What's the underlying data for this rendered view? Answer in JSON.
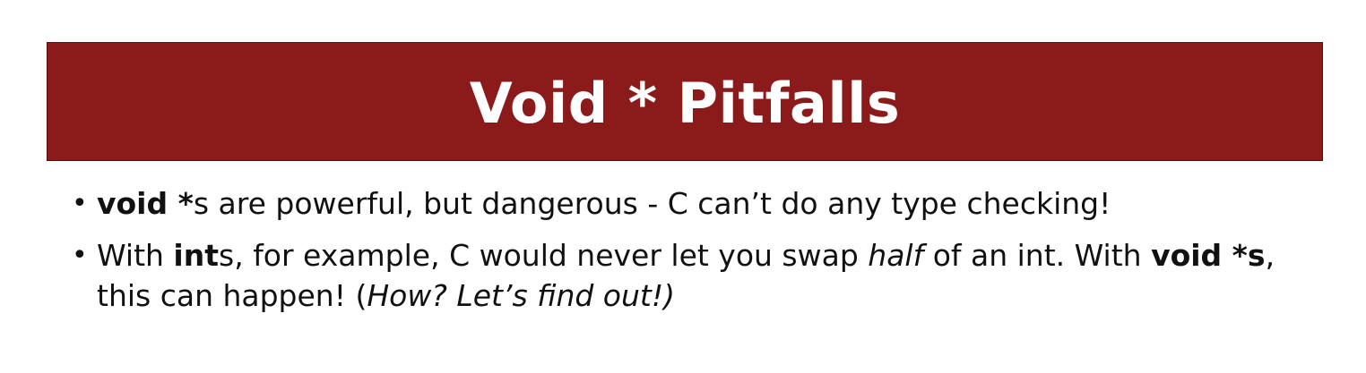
{
  "slide": {
    "title": "Void * Pitfalls",
    "title_bg_color": "#8b1a1a",
    "title_text_color": "#ffffff"
  },
  "bullets": [
    {
      "marker": "•",
      "parts": {
        "p1": "void *",
        "p2": "s are powerful, but dangerous - C can’t do any type checking!"
      }
    },
    {
      "marker": "•",
      "parts": {
        "p1": "With ",
        "p2": "int",
        "p3": "s, for example, C would never let you swap ",
        "p4": "half",
        "p5": " of an int.  With ",
        "p6": "void *s",
        "p7": ", this can happen! (",
        "p8": "How?  Let’s find out!)"
      }
    }
  ]
}
